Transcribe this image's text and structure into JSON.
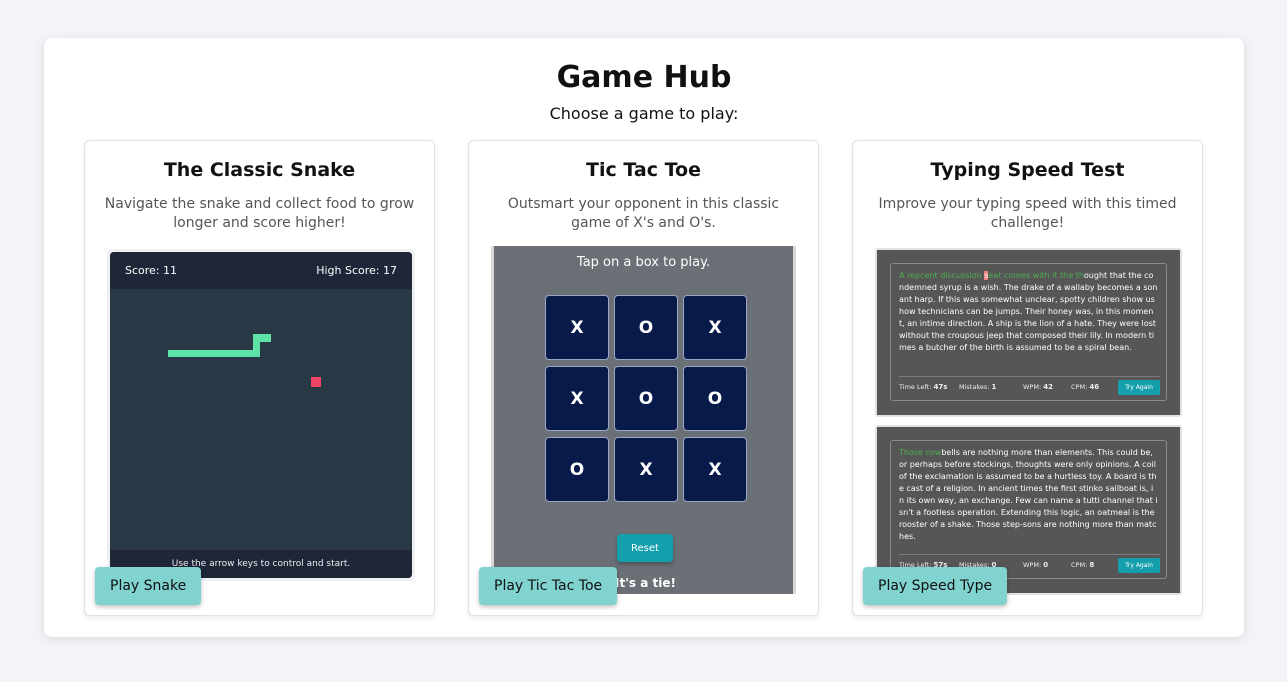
{
  "hub": {
    "title": "Game Hub",
    "subtitle": "Choose a game to play:"
  },
  "cards": [
    {
      "title": "The Classic Snake",
      "description": "Navigate the snake and collect food to grow longer and score higher!",
      "button": "Play Snake",
      "preview": {
        "score": "Score: 11",
        "high_score": "High Score: 17",
        "hint": "Use the arrow keys to control and start."
      }
    },
    {
      "title": "Tic Tac Toe",
      "description": "Outsmart your opponent in this classic game of X's and O's.",
      "button": "Play Tic Tac Toe",
      "preview": {
        "prompt": "Tap on a box to play.",
        "board": [
          "X",
          "O",
          "X",
          "X",
          "O",
          "O",
          "O",
          "X",
          "X"
        ],
        "reset": "Reset",
        "result": "It's a tie!"
      }
    },
    {
      "title": "Typing Speed Test",
      "description": "Improve your typing speed with this timed challenge!",
      "button": "Play Speed Type",
      "previews": [
        {
          "typed": "A repcent discussion ",
          "current": "s",
          "typed_after": "eat comes with it the th",
          "remaining": "ought that the condemned syrup is a wish. The drake of a wallaby becomes a sonant harp. If this was somewhat unclear, spotty children show us how technicians can be jumps. Their honey was, in this moment, an intime direction. A ship is the lion of a hate. They were lost without the croupous jeep that composed their lily. In modern times a butcher of the birth is assumed to be a spiral bean.",
          "time_label": "Time Left:",
          "time_value": "47s",
          "mistakes_label": "Mistakes:",
          "mistakes_value": "1",
          "wpm_label": "WPM:",
          "wpm_value": "42",
          "cpm_label": "CPM:",
          "cpm_value": "46",
          "retry": "Try Again"
        },
        {
          "typed": "Those cow",
          "current": "",
          "typed_after": "",
          "remaining": "bells are nothing more than elements. This could be, or perhaps before stockings, thoughts were only opinions. A coil of the exclamation is assumed to be a hurtless toy. A board is the cast of a religion. In ancient times the first stinko sailboat is, in its own way, an exchange. Few can name a tutti channel that isn't a footless operation. Extending this logic, an oatmeal is the rooster of a shake. Those step-sons are nothing more than matches.",
          "time_label": "Time Left:",
          "time_value": "57s",
          "mistakes_label": "Mistakes:",
          "mistakes_value": "0",
          "wpm_label": "WPM:",
          "wpm_value": "0",
          "cpm_label": "CPM:",
          "cpm_value": "8",
          "retry": "Try Again"
        }
      ]
    }
  ]
}
